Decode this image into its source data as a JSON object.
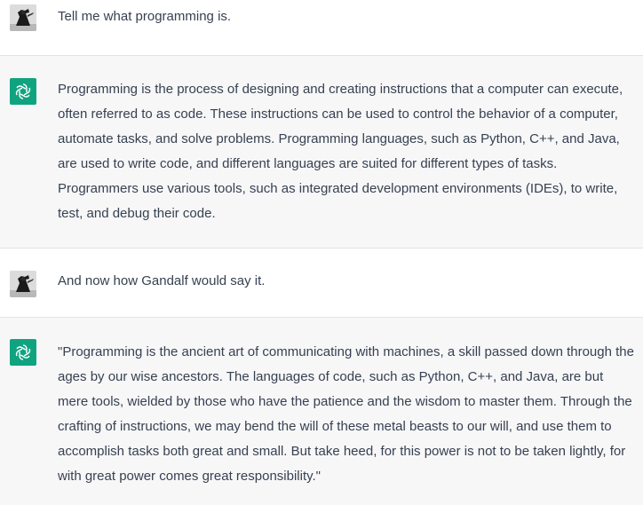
{
  "conversation": {
    "messages": [
      {
        "role": "user",
        "avatar_icon": "user-avatar",
        "text": "Tell me what programming is."
      },
      {
        "role": "assistant",
        "avatar_icon": "chatgpt-logo-icon",
        "text": "Programming is the process of designing and creating instructions that a computer can execute, often referred to as code. These instructions can be used to control the behavior of a computer, automate tasks, and solve problems. Programming languages, such as Python, C++, and Java, are used to write code, and different languages are suited for different types of tasks. Programmers use various tools, such as integrated development environments (IDEs), to write, test, and debug their code."
      },
      {
        "role": "user",
        "avatar_icon": "user-avatar",
        "text": "And now how Gandalf would say it."
      },
      {
        "role": "assistant",
        "avatar_icon": "chatgpt-logo-icon",
        "text": "\"Programming is the ancient art of communicating with machines, a skill passed down through the ages by our wise ancestors. The languages of code, such as Python, C++, and Java, are but mere tools, wielded by those who have the patience and the wisdom to master them. Through the crafting of instructions, we may bend the will of these metal beasts to our will, and use them to accomplish tasks both great and small. But take heed, for this power is not to be taken lightly, for with great power comes great responsibility.\""
      }
    ]
  },
  "colors": {
    "user_bg": "#ffffff",
    "assistant_bg": "#f7f7f8",
    "assistant_icon_bg": "#10a37f",
    "text": "#374151",
    "divider": "#e3e3e6"
  }
}
